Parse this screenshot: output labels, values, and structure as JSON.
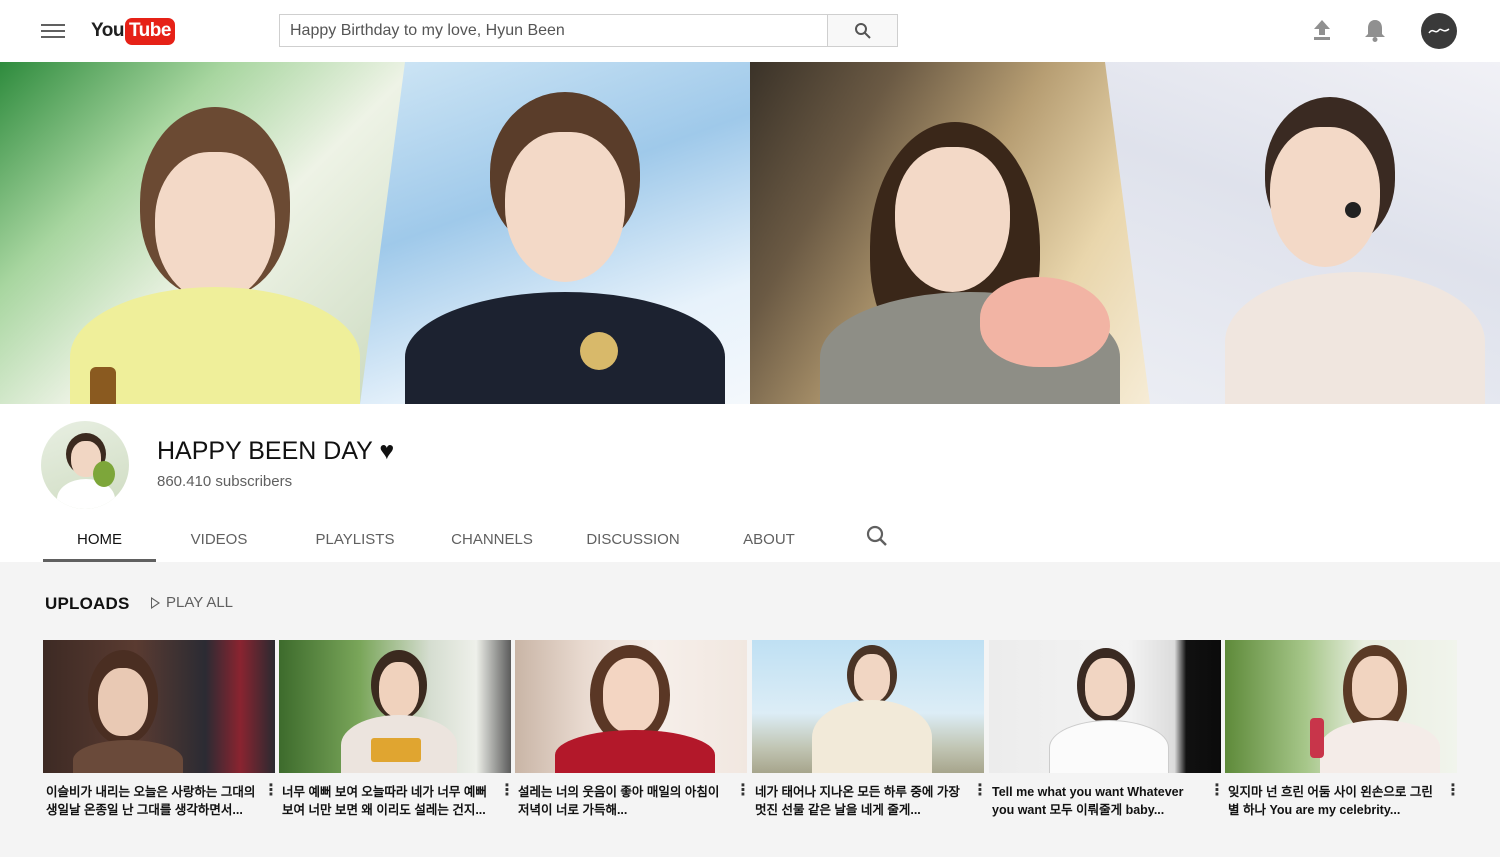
{
  "header": {
    "logo_you": "You",
    "logo_tube": "Tube",
    "search_value": "Happy Birthday to my love, Hyun Been",
    "icons": [
      "menu-icon",
      "search-icon",
      "upload-icon",
      "bell-icon",
      "account-avatar"
    ]
  },
  "channel": {
    "title": "HAPPY BEEN DAY ♥",
    "subscribers": "860.410 subscribers"
  },
  "tabs": [
    {
      "label": "HOME",
      "active": true
    },
    {
      "label": "VIDEOS",
      "active": false
    },
    {
      "label": "PLAYLISTS",
      "active": false
    },
    {
      "label": "CHANNELS",
      "active": false
    },
    {
      "label": "DISCUSSION",
      "active": false
    },
    {
      "label": "ABOUT",
      "active": false
    }
  ],
  "uploads": {
    "title": "UPLOADS",
    "play_all": "PLAY ALL",
    "videos": [
      {
        "title": "이슬비가 내리는 오늘은 사랑하는 그대의 생일날 온종일 난 그대를 생각하면서..."
      },
      {
        "title": "너무 예뻐 보여 오늘따라 네가 너무 예뻐 보여 너만 보면 왜 이리도 설레는 건지..."
      },
      {
        "title": "설레는 너의 웃음이 좋아 매일의 아침이 저녁이 너로 가득해..."
      },
      {
        "title": "네가 태어나 지나온 모든 하루 중에 가장 멋진 선물 같은 날을 네게 줄게..."
      },
      {
        "title": "Tell me what you want Whatever you want 모두 이뤄줄게 baby..."
      },
      {
        "title": "잊지마 넌 흐린 어둠 사이 왼손으로 그린 별 하나 You are my celebrity..."
      }
    ]
  },
  "colors": {
    "youtube_red": "#e62117",
    "text_primary": "#111111",
    "text_secondary": "#606060",
    "section_bg": "#f4f4f4"
  }
}
